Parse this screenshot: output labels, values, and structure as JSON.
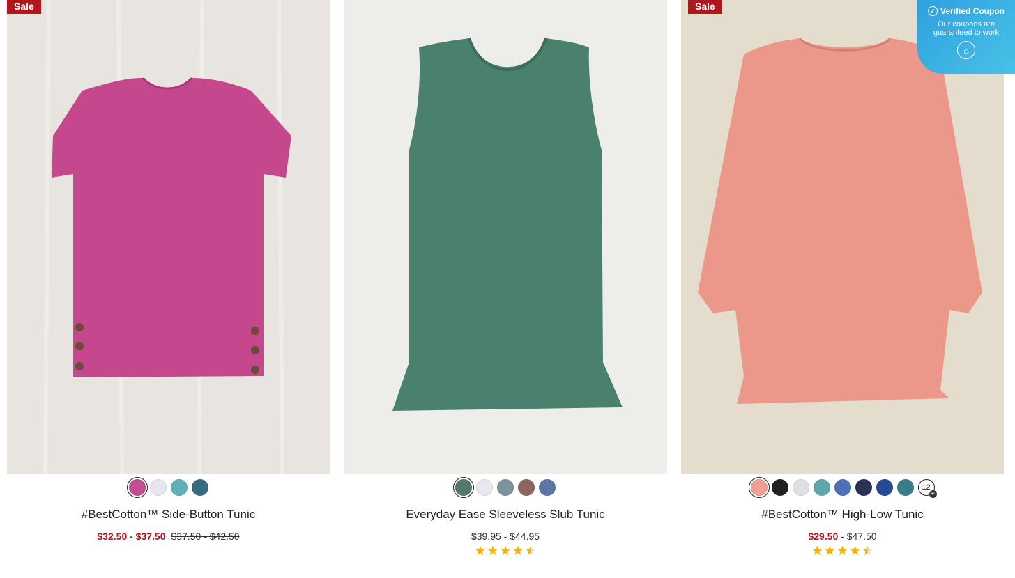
{
  "products": [
    {
      "badge": "Sale",
      "name": "#BestCotton™ Side-Button Tunic",
      "price_sale": "$32.50 - $37.50",
      "price_orig": "$37.50 - $42.50",
      "swatches": [
        "#c44e8f",
        "#e6e6ee",
        "#5fb0b7",
        "#386b7f"
      ],
      "shirt_color": "#c6488c"
    },
    {
      "name": "Everyday Ease Sleeveless Slub Tunic",
      "price": "$39.95 - $44.95",
      "rating": 4.5,
      "swatches": [
        "#55786b",
        "#e7e8f0",
        "#7c939c",
        "#8e6560",
        "#5c77a6"
      ],
      "shirt_color": "#4a806e"
    },
    {
      "badge": "Sale",
      "name": "#BestCotton™ High-Low Tunic",
      "price_sale": "$29.50",
      "price_sep": " - ",
      "price_rest": "$47.50",
      "rating": 4.5,
      "swatches": [
        "#eea094",
        "#222222",
        "#dedee3",
        "#5ea8aa",
        "#4d71b7",
        "#2a3355",
        "#254a96",
        "#377e88"
      ],
      "more_count": "12",
      "shirt_color": "#eb978a"
    }
  ],
  "coupon": {
    "title": "Verified Coupon",
    "text": "Our coupons are guaranteed to work"
  },
  "icons": [
    "check-circle-icon",
    "home-icon",
    "star-icon",
    "plus-icon"
  ]
}
